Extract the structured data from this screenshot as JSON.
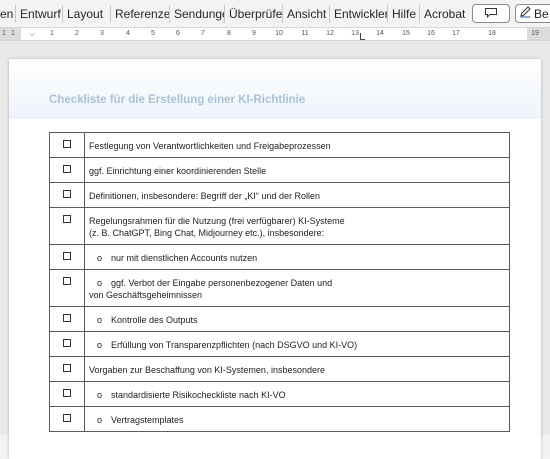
{
  "ribbon": {
    "tabs": [
      "en",
      "Entwurf",
      "Layout",
      "Referenze",
      "Sendunge",
      "Überprüfe",
      "Ansicht",
      "Entwickler",
      "Hilfe",
      "Acrobat"
    ],
    "comment_icon": "comment-icon",
    "edit_label": "Be",
    "edit_icon": "pencil-icon"
  },
  "ruler": {
    "left_numbers": [
      "1",
      "1"
    ],
    "numbers": [
      "1",
      "2",
      "3",
      "4",
      "5",
      "6",
      "7",
      "8",
      "9",
      "10",
      "11",
      "12",
      "13",
      "14",
      "15",
      "16",
      "17",
      "18",
      "19"
    ]
  },
  "document": {
    "title": "Checkliste für die Erstellung einer KI-Richtlinie",
    "rows": [
      {
        "checkbox": "☐",
        "text": "Festlegung von Verantwortlichkeiten und Freigabeprozessen",
        "bullet": ""
      },
      {
        "checkbox": "☐",
        "text": "ggf. Einrichtung einer koordinierenden Stelle",
        "bullet": ""
      },
      {
        "checkbox": "☐",
        "text": "Definitionen, insbesondere: Begriff der „KI“ und der Rollen",
        "bullet": ""
      },
      {
        "checkbox": "☐",
        "text": "Regelungsrahmen für die Nutzung (frei verfügbarer) KI-Systeme",
        "text2": "(z. B. ChatGPT, Bing Chat, Midjourney etc.), insbesondere:",
        "bullet": ""
      },
      {
        "checkbox": "☐",
        "text": "nur mit dienstlichen Accounts nutzen",
        "bullet": "o"
      },
      {
        "checkbox": "☐",
        "text": "ggf. Verbot der Eingabe personenbezogener Daten und",
        "text2": "von Geschäftsgeheimnissen",
        "bullet": "o"
      },
      {
        "checkbox": "☐",
        "text": "Kontrolle des Outputs",
        "bullet": "o"
      },
      {
        "checkbox": "☐",
        "text": "Erfüllung von Transparenzpflichten (nach DSGVO und KI-VO)",
        "bullet": "o"
      },
      {
        "checkbox": "☐",
        "text": "Vorgaben zur Beschaffung von KI-Systemen, insbesondere",
        "bullet": ""
      },
      {
        "checkbox": "☐",
        "text": "standardisierte Risikocheckliste nach KI-VO",
        "bullet": "o"
      },
      {
        "checkbox": "☐",
        "text": "Vertragstemplates",
        "bullet": "o"
      }
    ]
  }
}
